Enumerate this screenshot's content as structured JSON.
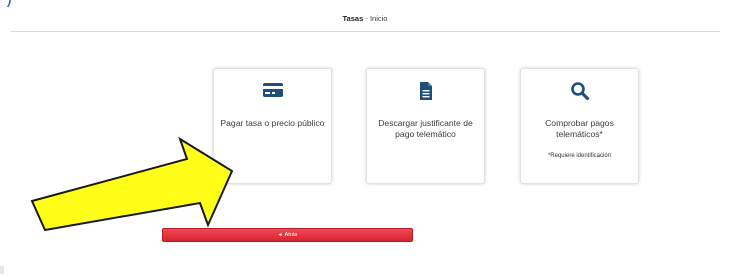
{
  "header": {
    "title": "Tasas",
    "separator": "-",
    "subtitle": "Inicio"
  },
  "cards": [
    {
      "label": "Pagar tasa o precio público",
      "icon": "credit-card-icon"
    },
    {
      "label": "Descargar justificante de pago telemático",
      "icon": "document-icon"
    },
    {
      "label": "Comprobar pagos telemáticos*",
      "note": "*Requiere identificación",
      "icon": "search-icon"
    }
  ],
  "exit_button": {
    "label": "Atrás",
    "icon": "back-icon"
  },
  "colors": {
    "icon": "#1f4e7a",
    "button": "#e0303b",
    "arrow_fill": "#ffff1a",
    "arrow_stroke": "#1a1a1a"
  }
}
